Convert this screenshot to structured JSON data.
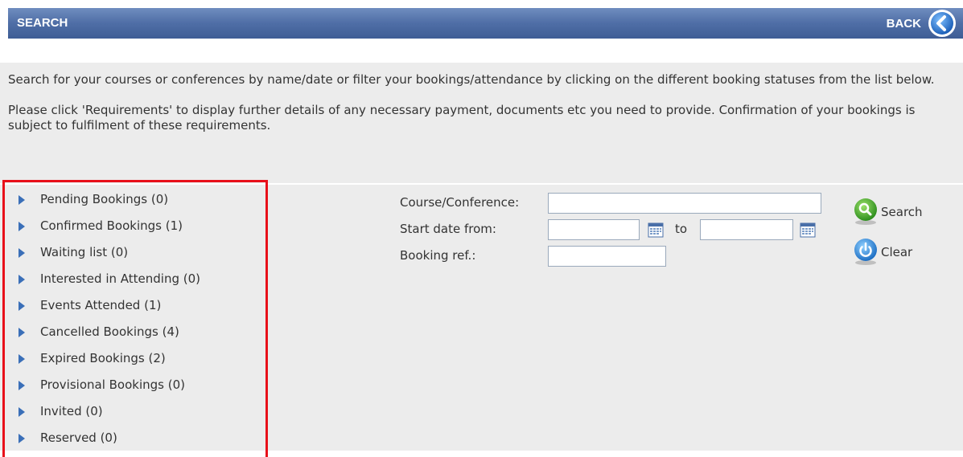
{
  "header": {
    "title": "SEARCH",
    "back_label": "BACK"
  },
  "intro": {
    "paragraph1": "Search for your courses or conferences by name/date or filter your bookings/attendance by clicking on the different booking statuses from the list below.",
    "paragraph2": "Please click 'Requirements' to display further details of any necessary payment, documents etc you need to provide. Confirmation of your bookings is subject to fulfilment of these requirements."
  },
  "status_list": [
    {
      "label": "Pending Bookings (0)"
    },
    {
      "label": "Confirmed Bookings (1)"
    },
    {
      "label": "Waiting list (0)"
    },
    {
      "label": "Interested in Attending (0)"
    },
    {
      "label": "Events Attended (1)"
    },
    {
      "label": "Cancelled Bookings (4)"
    },
    {
      "label": "Expired Bookings (2)"
    },
    {
      "label": "Provisional Bookings (0)"
    },
    {
      "label": "Invited (0)"
    },
    {
      "label": "Reserved (0)"
    }
  ],
  "form": {
    "course_label": "Course/Conference:",
    "course_value": "",
    "start_date_label": "Start date from:",
    "date_from_value": "",
    "to_label": "to",
    "date_to_value": "",
    "booking_ref_label": "Booking ref.:",
    "booking_ref_value": ""
  },
  "actions": {
    "search_label": "Search",
    "clear_label": "Clear"
  },
  "colors": {
    "header": "#4f6ea6",
    "content_bg": "#ececec",
    "highlight_border": "#e8101a",
    "arrow": "#3a6fb8"
  },
  "icons": [
    "back-arrow-icon",
    "calendar-icon",
    "search-icon",
    "clear-icon",
    "triangle-right-icon"
  ]
}
